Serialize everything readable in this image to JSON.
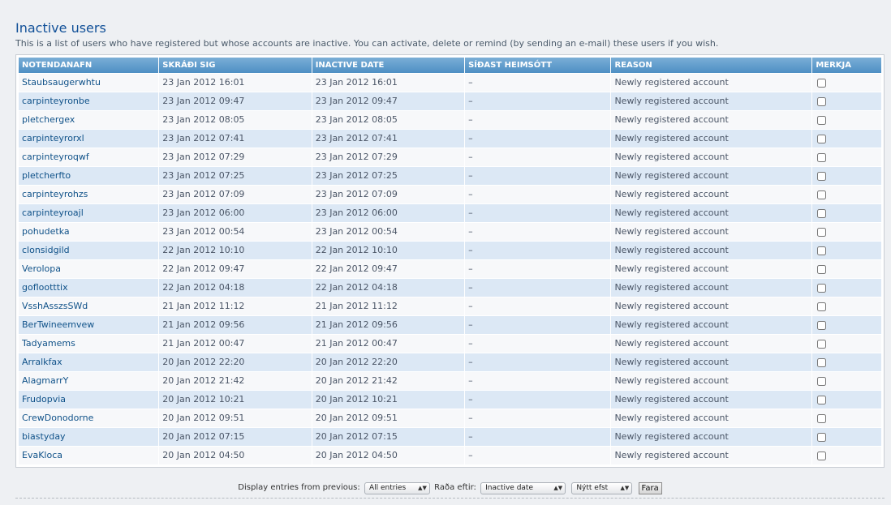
{
  "header": {
    "title": "Inactive users",
    "description": "This is a list of users who have registered but whose accounts are inactive. You can activate, delete or remind (by sending an e-mail) these users if you wish."
  },
  "table": {
    "columns": [
      "NOTENDANAFN",
      "SKRÁÐI SIG",
      "INACTIVE DATE",
      "SÍÐAST HEIMSÓTT",
      "REASON",
      "MERKJA"
    ],
    "rows": [
      {
        "username": "Staubsaugerwhtu",
        "registered": "23 Jan 2012 16:01",
        "inactive": "23 Jan 2012 16:01",
        "last_visit": "–",
        "reason": "Newly registered account"
      },
      {
        "username": "carpinteyronbe",
        "registered": "23 Jan 2012 09:47",
        "inactive": "23 Jan 2012 09:47",
        "last_visit": "–",
        "reason": "Newly registered account"
      },
      {
        "username": "pletchergex",
        "registered": "23 Jan 2012 08:05",
        "inactive": "23 Jan 2012 08:05",
        "last_visit": "–",
        "reason": "Newly registered account"
      },
      {
        "username": "carpinteyrorxl",
        "registered": "23 Jan 2012 07:41",
        "inactive": "23 Jan 2012 07:41",
        "last_visit": "–",
        "reason": "Newly registered account"
      },
      {
        "username": "carpinteyroqwf",
        "registered": "23 Jan 2012 07:29",
        "inactive": "23 Jan 2012 07:29",
        "last_visit": "–",
        "reason": "Newly registered account"
      },
      {
        "username": "pletcherfto",
        "registered": "23 Jan 2012 07:25",
        "inactive": "23 Jan 2012 07:25",
        "last_visit": "–",
        "reason": "Newly registered account"
      },
      {
        "username": "carpinteyrohzs",
        "registered": "23 Jan 2012 07:09",
        "inactive": "23 Jan 2012 07:09",
        "last_visit": "–",
        "reason": "Newly registered account"
      },
      {
        "username": "carpinteyroajl",
        "registered": "23 Jan 2012 06:00",
        "inactive": "23 Jan 2012 06:00",
        "last_visit": "–",
        "reason": "Newly registered account"
      },
      {
        "username": "pohudetka",
        "registered": "23 Jan 2012 00:54",
        "inactive": "23 Jan 2012 00:54",
        "last_visit": "–",
        "reason": "Newly registered account"
      },
      {
        "username": "clonsidgild",
        "registered": "22 Jan 2012 10:10",
        "inactive": "22 Jan 2012 10:10",
        "last_visit": "–",
        "reason": "Newly registered account"
      },
      {
        "username": "Verolopa",
        "registered": "22 Jan 2012 09:47",
        "inactive": "22 Jan 2012 09:47",
        "last_visit": "–",
        "reason": "Newly registered account"
      },
      {
        "username": "goflootttix",
        "registered": "22 Jan 2012 04:18",
        "inactive": "22 Jan 2012 04:18",
        "last_visit": "–",
        "reason": "Newly registered account"
      },
      {
        "username": "VsshAsszsSWd",
        "registered": "21 Jan 2012 11:12",
        "inactive": "21 Jan 2012 11:12",
        "last_visit": "–",
        "reason": "Newly registered account"
      },
      {
        "username": "BerTwineemvew",
        "registered": "21 Jan 2012 09:56",
        "inactive": "21 Jan 2012 09:56",
        "last_visit": "–",
        "reason": "Newly registered account"
      },
      {
        "username": "Tadyamems",
        "registered": "21 Jan 2012 00:47",
        "inactive": "21 Jan 2012 00:47",
        "last_visit": "–",
        "reason": "Newly registered account"
      },
      {
        "username": "Arralkfax",
        "registered": "20 Jan 2012 22:20",
        "inactive": "20 Jan 2012 22:20",
        "last_visit": "–",
        "reason": "Newly registered account"
      },
      {
        "username": "AlagmarrY",
        "registered": "20 Jan 2012 21:42",
        "inactive": "20 Jan 2012 21:42",
        "last_visit": "–",
        "reason": "Newly registered account"
      },
      {
        "username": "Frudopvia",
        "registered": "20 Jan 2012 10:21",
        "inactive": "20 Jan 2012 10:21",
        "last_visit": "–",
        "reason": "Newly registered account"
      },
      {
        "username": "CrewDonodorne",
        "registered": "20 Jan 2012 09:51",
        "inactive": "20 Jan 2012 09:51",
        "last_visit": "–",
        "reason": "Newly registered account"
      },
      {
        "username": "biastyday",
        "registered": "20 Jan 2012 07:15",
        "inactive": "20 Jan 2012 07:15",
        "last_visit": "–",
        "reason": "Newly registered account"
      },
      {
        "username": "EvaKloca",
        "registered": "20 Jan 2012 04:50",
        "inactive": "20 Jan 2012 04:50",
        "last_visit": "–",
        "reason": "Newly registered account"
      }
    ]
  },
  "controls": {
    "display_label": "Display entries from previous:",
    "display_value": "All entries",
    "sort_label": "Raða eftir:",
    "sort_value": "Inactive date",
    "order_value": "Nýtt efst",
    "go_label": "Fara"
  },
  "colors": {
    "title": "#115098",
    "header_bg": "#5a97c9",
    "row_alt": "#dce8f5",
    "link": "#105289"
  }
}
